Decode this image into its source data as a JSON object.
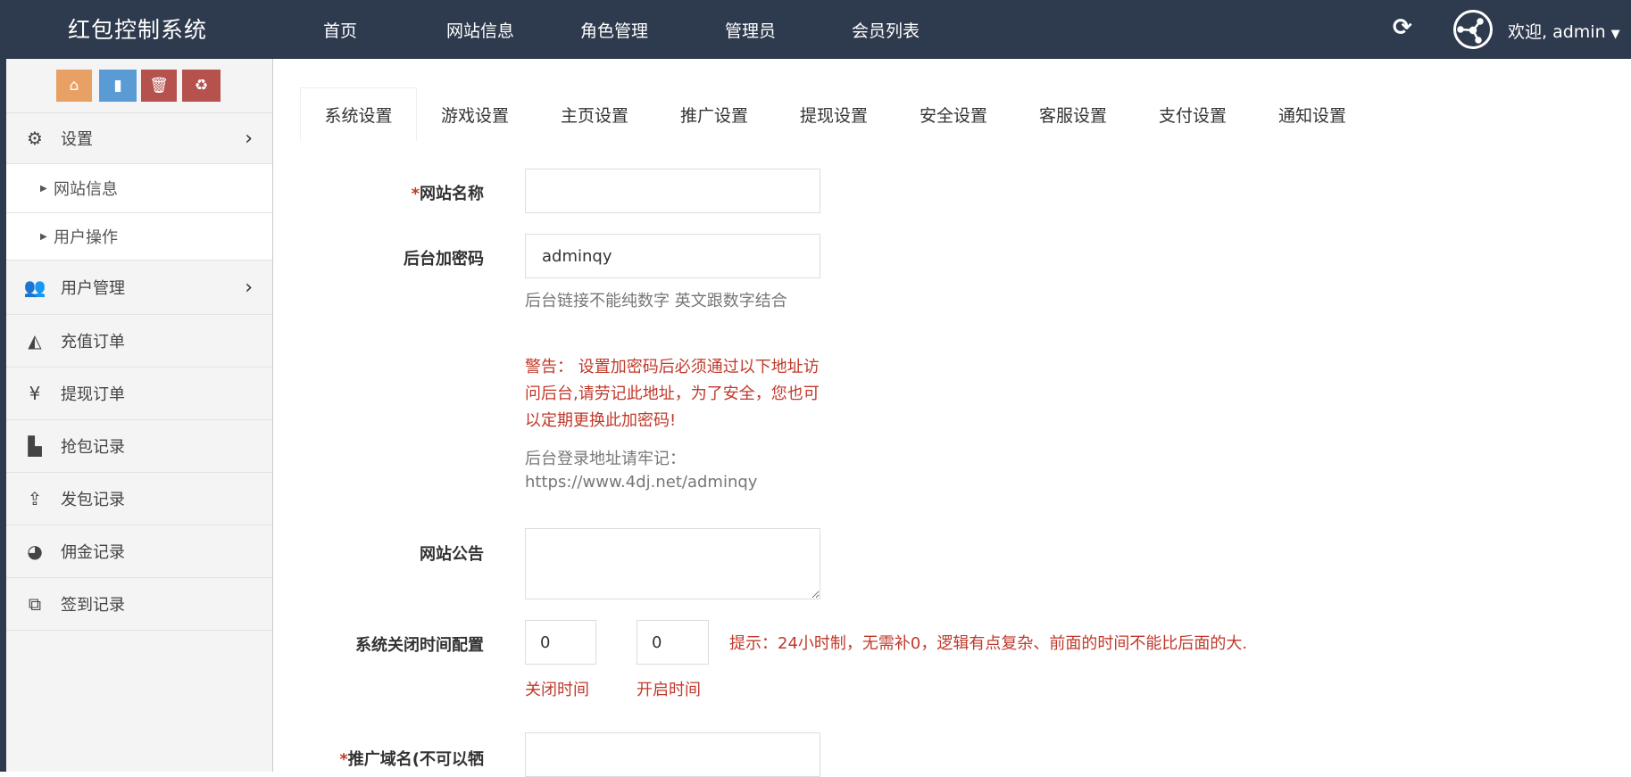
{
  "header": {
    "brand": "红包控制系统",
    "nav": [
      "首页",
      "网站信息",
      "角色管理",
      "管理员",
      "会员列表"
    ],
    "welcome": "欢迎, admin"
  },
  "sidebar": {
    "tool_buttons": [
      "home-icon",
      "file-icon",
      "trash-icon",
      "recycle-icon"
    ],
    "menu": [
      {
        "label": "设置",
        "icon": "gears-icon"
      },
      {
        "label": "网站信息"
      },
      {
        "label": "用户操作"
      },
      {
        "label": "用户管理",
        "icon": "users-icon"
      },
      {
        "label": "充值订单",
        "icon": "area-chart-icon"
      },
      {
        "label": "提现订单",
        "icon": "yen-icon"
      },
      {
        "label": "抢包记录",
        "icon": "bar-chart-icon"
      },
      {
        "label": "发包记录",
        "icon": "upload-icon"
      },
      {
        "label": "佣金记录",
        "icon": "pie-chart-icon"
      },
      {
        "label": "签到记录",
        "icon": "clone-icon"
      }
    ]
  },
  "tabs": [
    "系统设置",
    "游戏设置",
    "主页设置",
    "推广设置",
    "提现设置",
    "安全设置",
    "客服设置",
    "支付设置",
    "通知设置"
  ],
  "form": {
    "site_name": {
      "label": "网站名称",
      "value": ""
    },
    "admin_code": {
      "label": "后台加密码",
      "value": "adminqy",
      "help": "后台链接不能纯数字 英文跟数字结合",
      "warning": "警告： 设置加密码后必须通过以下地址访问后台,请劳记此地址，为了安全，您也可以定期更换此加密码!",
      "login_label": "后台登录地址请牢记：",
      "login_url": "https://www.4dj.net/adminqy"
    },
    "notice": {
      "label": "网站公告",
      "value": ""
    },
    "close_time": {
      "label": "系统关闭时间配置",
      "close_value": "0",
      "open_value": "0",
      "close_caption": "关闭时间",
      "open_caption": "开启时间",
      "hint": "提示：24小时制，无需补0，逻辑有点复杂、前面的时间不能比后面的大."
    },
    "promo_domain": {
      "label": "推广域名(不可以牺",
      "value": ""
    }
  },
  "colors": {
    "header": "#2e3a4d",
    "warn": "#c0392b",
    "orange": "#e8a064",
    "blue": "#5b9bd5",
    "red": "#b5524e"
  }
}
